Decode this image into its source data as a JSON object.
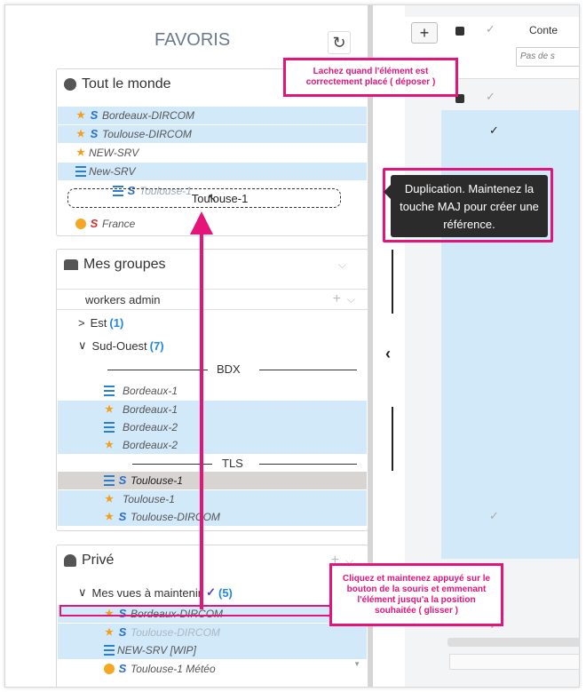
{
  "favoris": {
    "title": "FAVORIS"
  },
  "toolbar": {
    "add_label": "+",
    "cont_label": "Conte",
    "filter_placeholder": "Pas de s"
  },
  "tout_le_monde": {
    "title": "Tout le monde",
    "items": [
      {
        "label": "Bordeaux-DIRCOM"
      },
      {
        "label": "Toulouse-DIRCOM"
      },
      {
        "label": "NEW-SRV"
      },
      {
        "label": "New-SRV"
      },
      {
        "label": "Toulouse-1"
      },
      {
        "label": "France"
      }
    ],
    "drag_label": "Toulouse-1"
  },
  "mes_groupes": {
    "title": "Mes groupes",
    "group": "workers admin",
    "est": {
      "label": "Est",
      "count": "(1)"
    },
    "sud_ouest": {
      "label": "Sud-Ouest",
      "count": "(7)"
    },
    "bdx_label": "BDX",
    "tls_label": "TLS",
    "bdx_items": [
      {
        "label": "Bordeaux-1"
      },
      {
        "label": "Bordeaux-1"
      },
      {
        "label": "Bordeaux-2"
      },
      {
        "label": "Bordeaux-2"
      }
    ],
    "tls_items": [
      {
        "label": "Toulouse-1"
      },
      {
        "label": "Toulouse-1"
      },
      {
        "label": "Toulouse-DIRCOM"
      }
    ]
  },
  "prive": {
    "title": "Privé",
    "folder": {
      "label": "Mes vues à maintenir",
      "count": "(5)"
    },
    "items": [
      {
        "label": "Bordeaux-DIRCOM"
      },
      {
        "label": "Toulouse-DIRCOM"
      },
      {
        "label": "NEW-SRV [WIP]"
      },
      {
        "label": "Toulouse-1 Météo"
      }
    ]
  },
  "annotations": {
    "drop": "Lachez quand l'élément est correctement placé ( déposer )",
    "drag": "Cliquez et maintenez appuyé sur le bouton de la souris et emmenant l'élément jusqu'a la position souhaitée ( glisser )",
    "tooltip": "Duplication. Maintenez la touche MAJ pour créer une référence."
  },
  "colors": {
    "accent": "#e4147a",
    "selected": "#d2e9fa",
    "link": "#1e88e5"
  }
}
